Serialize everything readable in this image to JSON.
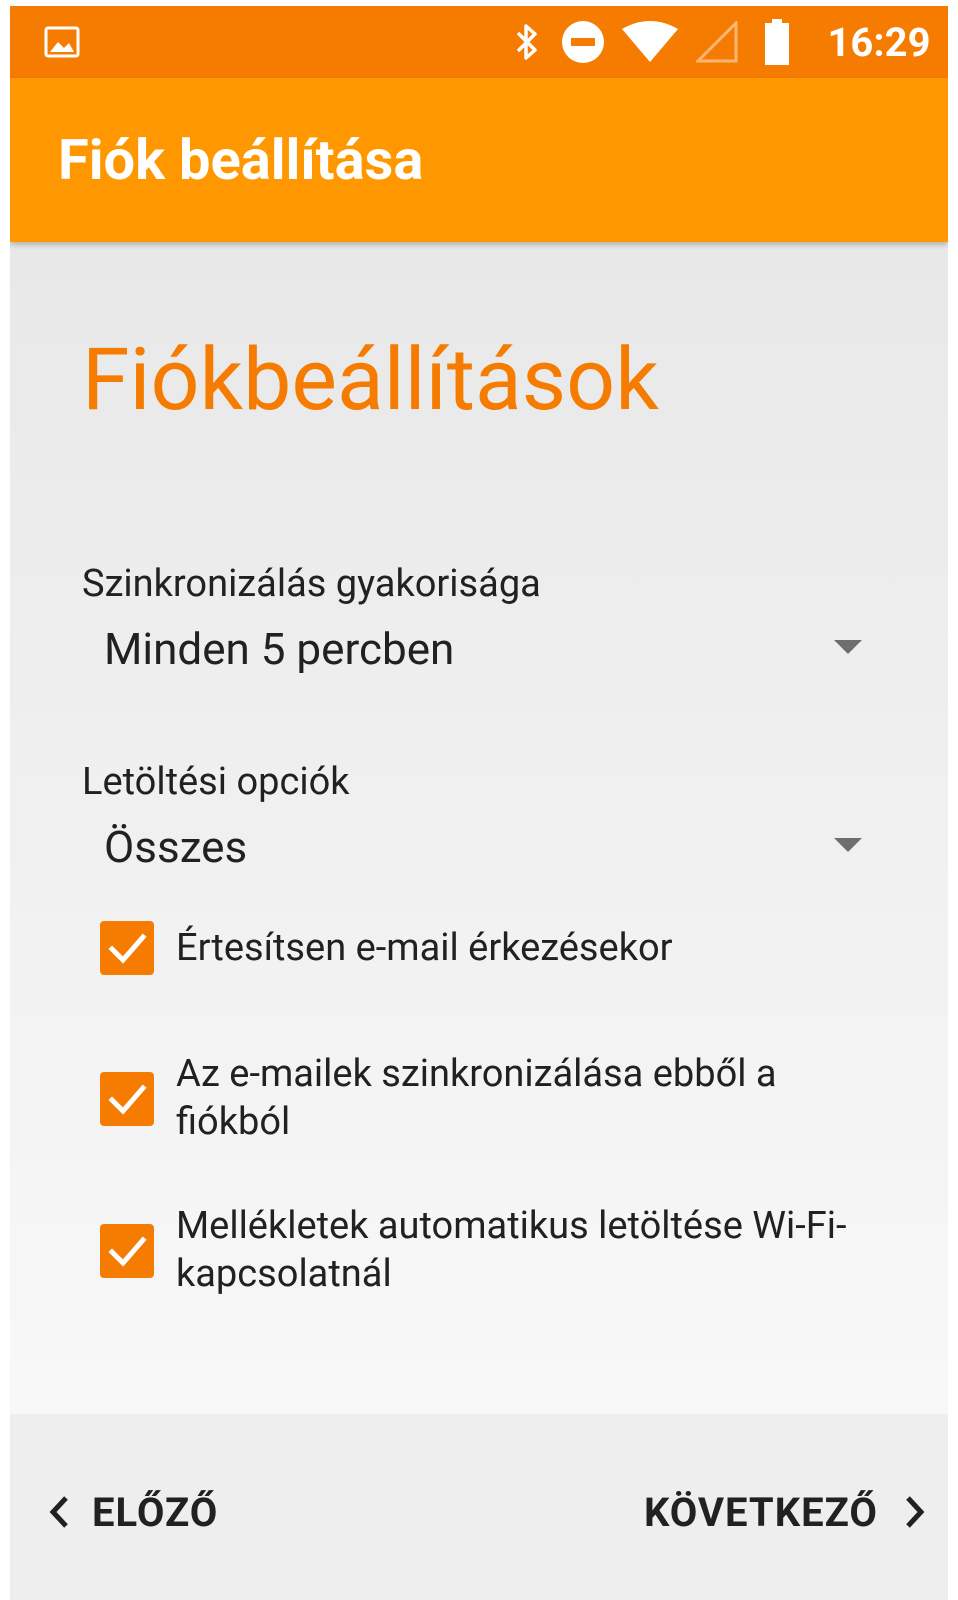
{
  "status_bar": {
    "time": "16:29",
    "icons": [
      "image-notification-icon",
      "bluetooth-icon",
      "do-not-disturb-icon",
      "wifi-icon",
      "no-signal-icon",
      "battery-icon"
    ]
  },
  "toolbar": {
    "title": "Fiók beállítása"
  },
  "main": {
    "heading": "Fiókbeállítások",
    "sync_frequency": {
      "label": "Szinkronizálás gyakorisága",
      "value": "Minden 5 percben"
    },
    "download_options": {
      "label": "Letöltési opciók",
      "value": "Összes"
    },
    "checkboxes": [
      {
        "label": "Értesítsen e-mail érkezésekor",
        "checked": true
      },
      {
        "label": "Az e-mailek szinkronizálása ebből a fiókból",
        "checked": true
      },
      {
        "label": "Mellékletek automatikus letöltése Wi-Fi-kapcsolatnál",
        "checked": true
      }
    ]
  },
  "navigation": {
    "previous_label": "ELŐZŐ",
    "next_label": "KÖVETKEZŐ"
  },
  "colors": {
    "status_bar": "#F57C00",
    "toolbar": "#FF9800",
    "accent": "#F57C00"
  }
}
